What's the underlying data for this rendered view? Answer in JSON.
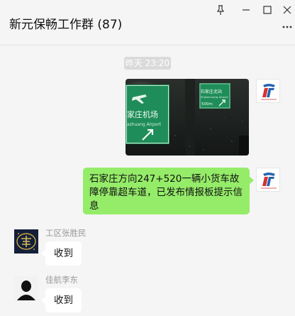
{
  "window": {
    "title": "新元保畅工作群 (87)",
    "controls": [
      "pin-icon",
      "minimize-icon",
      "maximize-icon",
      "close-icon"
    ],
    "more_icon": "more-icon"
  },
  "chat": {
    "timestamp": "昨天 23:20",
    "messages": [
      {
        "type": "image",
        "from": "self",
        "sign_text": {
          "name_cn": "家庄机场",
          "name_en": "azhuang Airport",
          "right_cn": "石家庄北站",
          "right_en": "Shijiazhuang Airport",
          "distance": "500m"
        }
      },
      {
        "type": "text",
        "from": "self",
        "text": "石家庄方向247+520一辆小货车故障停靠超车道，已发布情报板提示信息"
      },
      {
        "type": "text",
        "from": "other",
        "sender": "工区张胜民",
        "text": "收到"
      },
      {
        "type": "text",
        "from": "other",
        "sender": "佳航李东",
        "text": "收到"
      }
    ]
  },
  "colors": {
    "self_bubble": "#95ec69",
    "other_bubble": "#ffffff",
    "background": "#f5f5f5",
    "sign_green": "#1f8d59"
  }
}
